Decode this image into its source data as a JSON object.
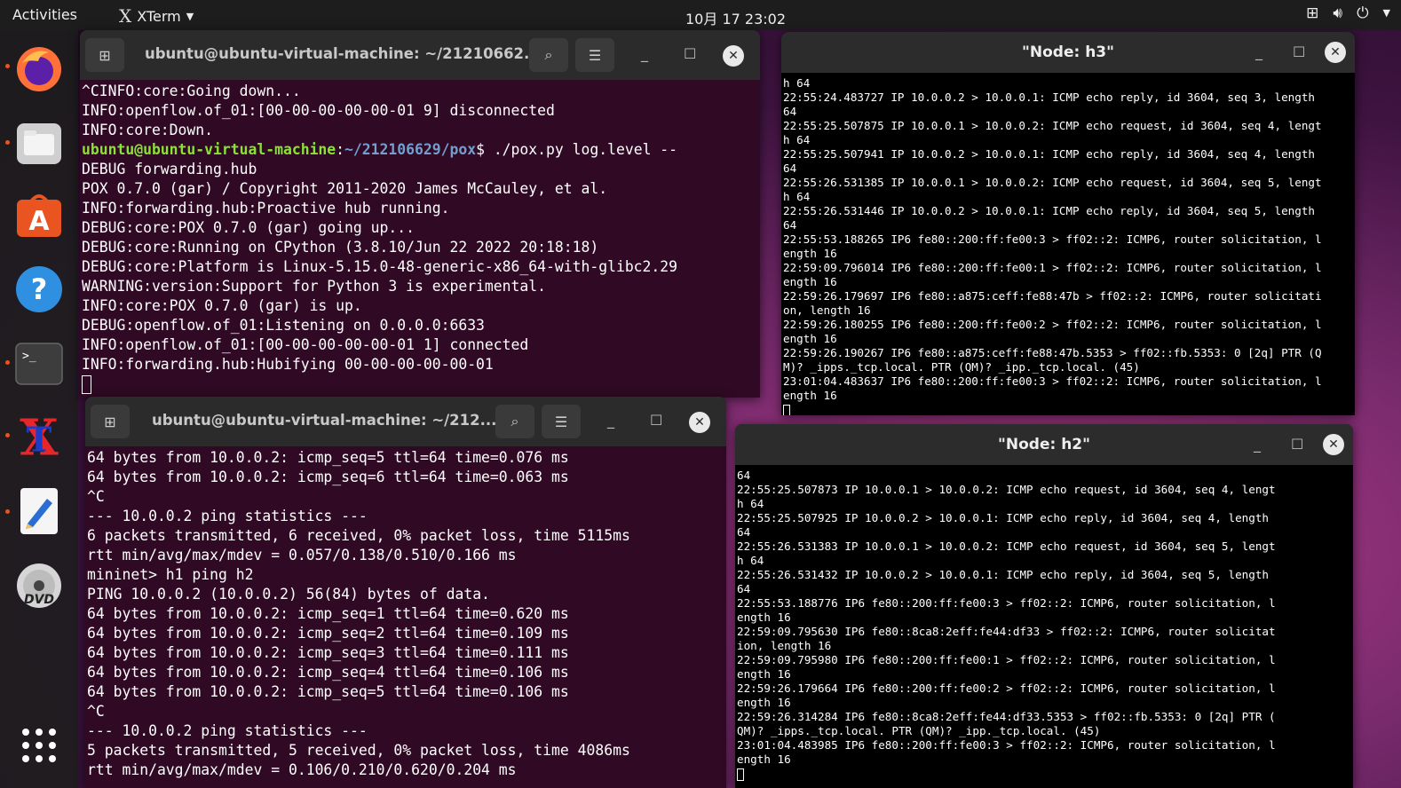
{
  "topbar": {
    "activities": "Activities",
    "app_name": "XTerm",
    "clock": "10月 17 23:02"
  },
  "dock": {
    "items": [
      "firefox-icon",
      "files-icon",
      "app-store-icon",
      "help-icon",
      "terminal-icon",
      "xterm-icon",
      "text-editor-icon",
      "dvd-icon",
      "show-apps-icon"
    ]
  },
  "term1": {
    "title": "ubuntu@ubuntu-virtual-machine: ~/21210662...",
    "lines_before": [
      "^CINFO:core:Going down...",
      "INFO:openflow.of_01:[00-00-00-00-00-01 9] disconnected",
      "INFO:core:Down."
    ],
    "prompt_user": "ubuntu@ubuntu-virtual-machine",
    "prompt_sep": ":",
    "prompt_path": "~/212106629/pox",
    "prompt_cmd": "$ ./pox.py log.level --",
    "lines_after": [
      "DEBUG forwarding.hub",
      "POX 0.7.0 (gar) / Copyright 2011-2020 James McCauley, et al.",
      "INFO:forwarding.hub:Proactive hub running.",
      "DEBUG:core:POX 0.7.0 (gar) going up...",
      "DEBUG:core:Running on CPython (3.8.10/Jun 22 2022 20:18:18)",
      "DEBUG:core:Platform is Linux-5.15.0-48-generic-x86_64-with-glibc2.29",
      "WARNING:version:Support for Python 3 is experimental.",
      "INFO:core:POX 0.7.0 (gar) is up.",
      "DEBUG:openflow.of_01:Listening on 0.0.0.0:6633",
      "INFO:openflow.of_01:[00-00-00-00-00-01 1] connected",
      "INFO:forwarding.hub:Hubifying 00-00-00-00-00-01"
    ]
  },
  "term2": {
    "title": "ubuntu@ubuntu-virtual-machine: ~/212...",
    "lines": [
      "64 bytes from 10.0.0.2: icmp_seq=5 ttl=64 time=0.076 ms",
      "64 bytes from 10.0.0.2: icmp_seq=6 ttl=64 time=0.063 ms",
      "^C",
      "--- 10.0.0.2 ping statistics ---",
      "6 packets transmitted, 6 received, 0% packet loss, time 5115ms",
      "rtt min/avg/max/mdev = 0.057/0.138/0.510/0.166 ms",
      "mininet> h1 ping h2",
      "PING 10.0.0.2 (10.0.0.2) 56(84) bytes of data.",
      "64 bytes from 10.0.0.2: icmp_seq=1 ttl=64 time=0.620 ms",
      "64 bytes from 10.0.0.2: icmp_seq=2 ttl=64 time=0.109 ms",
      "64 bytes from 10.0.0.2: icmp_seq=3 ttl=64 time=0.111 ms",
      "64 bytes from 10.0.0.2: icmp_seq=4 ttl=64 time=0.106 ms",
      "64 bytes from 10.0.0.2: icmp_seq=5 ttl=64 time=0.106 ms",
      "^C",
      "--- 10.0.0.2 ping statistics ---",
      "5 packets transmitted, 5 received, 0% packet loss, time 4086ms",
      "rtt min/avg/max/mdev = 0.106/0.210/0.620/0.204 ms"
    ]
  },
  "h3": {
    "title": "\"Node: h3\"",
    "lines": [
      "h 64",
      "22:55:24.483727 IP 10.0.0.2 > 10.0.0.1: ICMP echo reply, id 3604, seq 3, length",
      "64",
      "22:55:25.507875 IP 10.0.0.1 > 10.0.0.2: ICMP echo request, id 3604, seq 4, lengt",
      "h 64",
      "22:55:25.507941 IP 10.0.0.2 > 10.0.0.1: ICMP echo reply, id 3604, seq 4, length",
      "64",
      "22:55:26.531385 IP 10.0.0.1 > 10.0.0.2: ICMP echo request, id 3604, seq 5, lengt",
      "h 64",
      "22:55:26.531446 IP 10.0.0.2 > 10.0.0.1: ICMP echo reply, id 3604, seq 5, length",
      "64",
      "22:55:53.188265 IP6 fe80::200:ff:fe00:3 > ff02::2: ICMP6, router solicitation, l",
      "ength 16",
      "22:59:09.796014 IP6 fe80::200:ff:fe00:1 > ff02::2: ICMP6, router solicitation, l",
      "ength 16",
      "22:59:26.179697 IP6 fe80::a875:ceff:fe88:47b > ff02::2: ICMP6, router solicitati",
      "on, length 16",
      "22:59:26.180255 IP6 fe80::200:ff:fe00:2 > ff02::2: ICMP6, router solicitation, l",
      "ength 16",
      "22:59:26.190267 IP6 fe80::a875:ceff:fe88:47b.5353 > ff02::fb.5353: 0 [2q] PTR (Q",
      "M)? _ipps._tcp.local. PTR (QM)? _ipp._tcp.local. (45)",
      "23:01:04.483637 IP6 fe80::200:ff:fe00:3 > ff02::2: ICMP6, router solicitation, l",
      "ength 16"
    ]
  },
  "h2": {
    "title": "\"Node: h2\"",
    "lines": [
      "64",
      "22:55:25.507873 IP 10.0.0.1 > 10.0.0.2: ICMP echo request, id 3604, seq 4, lengt",
      "h 64",
      "22:55:25.507925 IP 10.0.0.2 > 10.0.0.1: ICMP echo reply, id 3604, seq 4, length",
      "64",
      "22:55:26.531383 IP 10.0.0.1 > 10.0.0.2: ICMP echo request, id 3604, seq 5, lengt",
      "h 64",
      "22:55:26.531432 IP 10.0.0.2 > 10.0.0.1: ICMP echo reply, id 3604, seq 5, length",
      "64",
      "22:55:53.188776 IP6 fe80::200:ff:fe00:3 > ff02::2: ICMP6, router solicitation, l",
      "ength 16",
      "22:59:09.795630 IP6 fe80::8ca8:2eff:fe44:df33 > ff02::2: ICMP6, router solicitat",
      "ion, length 16",
      "22:59:09.795980 IP6 fe80::200:ff:fe00:1 > ff02::2: ICMP6, router solicitation, l",
      "ength 16",
      "22:59:26.179664 IP6 fe80::200:ff:fe00:2 > ff02::2: ICMP6, router solicitation, l",
      "ength 16",
      "22:59:26.314284 IP6 fe80::8ca8:2eff:fe44:df33.5353 > ff02::fb.5353: 0 [2q] PTR (",
      "QM)? _ipps._tcp.local. PTR (QM)? _ipp._tcp.local. (45)",
      "23:01:04.483985 IP6 fe80::200:ff:fe00:3 > ff02::2: ICMP6, router solicitation, l",
      "ength 16"
    ]
  },
  "colors": {
    "terminal_bg": "#300a24",
    "prompt_user": "#8ae234",
    "prompt_path": "#729fcf",
    "accent": "#e95420"
  }
}
